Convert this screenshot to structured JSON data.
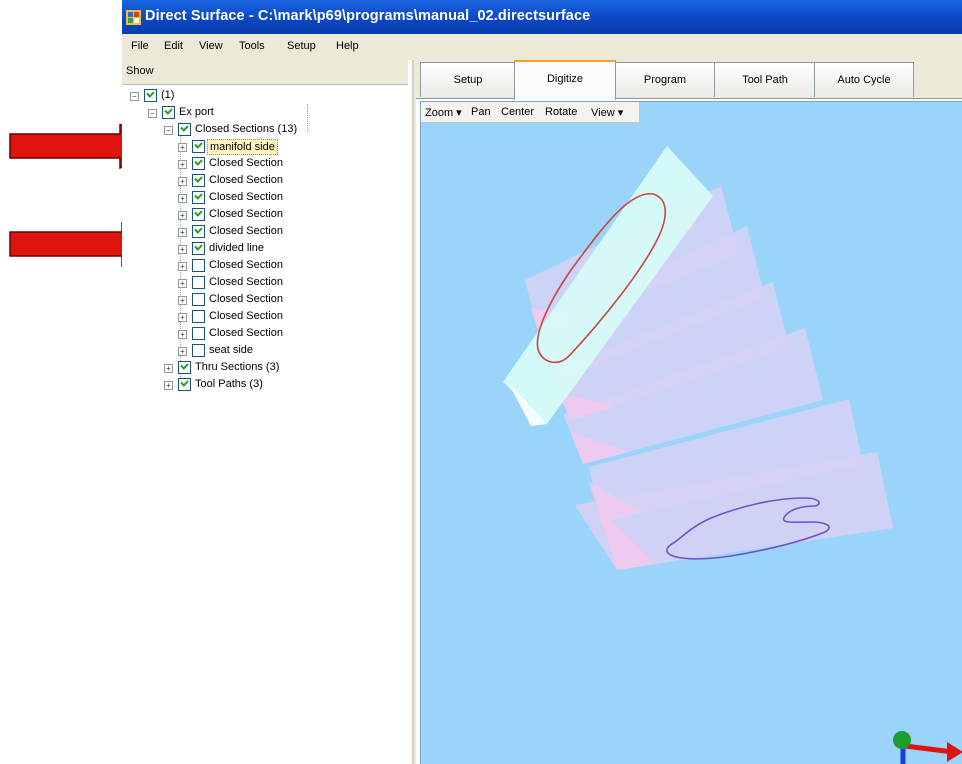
{
  "window": {
    "title": "Direct Surface - C:\\mark\\p69\\programs\\manual_02.directsurface"
  },
  "menu": [
    "File",
    "Edit",
    "View",
    "Tools",
    "Setup",
    "Help"
  ],
  "left_panel": {
    "header": "Show",
    "tree": {
      "root": {
        "label": "(1)",
        "checked": true
      },
      "export": {
        "label": "Ex port",
        "checked": true
      },
      "closed_sections": {
        "label": "Closed Sections (13)",
        "checked": true
      },
      "children": [
        {
          "label": "manifold side",
          "checked": true,
          "selected": true
        },
        {
          "label": "Closed Section",
          "checked": true
        },
        {
          "label": "Closed Section",
          "checked": true
        },
        {
          "label": "Closed Section",
          "checked": true
        },
        {
          "label": "Closed Section",
          "checked": true
        },
        {
          "label": "Closed Section",
          "checked": true
        },
        {
          "label": "divided line",
          "checked": true
        },
        {
          "label": "Closed Section",
          "checked": false
        },
        {
          "label": "Closed Section",
          "checked": false
        },
        {
          "label": "Closed Section",
          "checked": false
        },
        {
          "label": "Closed Section",
          "checked": false
        },
        {
          "label": "Closed Section",
          "checked": false
        },
        {
          "label": "seat side",
          "checked": false
        }
      ],
      "thru_sections": {
        "label": "Thru Sections (3)",
        "checked": true
      },
      "tool_paths": {
        "label": "Tool Paths (3)",
        "checked": true
      }
    }
  },
  "tabs": [
    {
      "label": "Setup",
      "active": false
    },
    {
      "label": "Digitize",
      "active": true
    },
    {
      "label": "Program",
      "active": false
    },
    {
      "label": "Tool Path",
      "active": false
    },
    {
      "label": "Auto Cycle",
      "active": false
    }
  ],
  "view_toolbar": [
    "Zoom ▾",
    "Pan",
    "Center",
    "Rotate",
    "View ▾"
  ],
  "colors": {
    "viewport_bg": "#9bd4fa",
    "title_bar": "#0a45c4",
    "active_tab_accent": "#f7a12a",
    "annotation_arrow": "#e0140f",
    "section_top": "#d6fbf8",
    "section": "#d6d2f4",
    "section_pink": "#f5c8ee",
    "contour_red": "#c8473f",
    "contour_purple": "#6e53c8"
  }
}
